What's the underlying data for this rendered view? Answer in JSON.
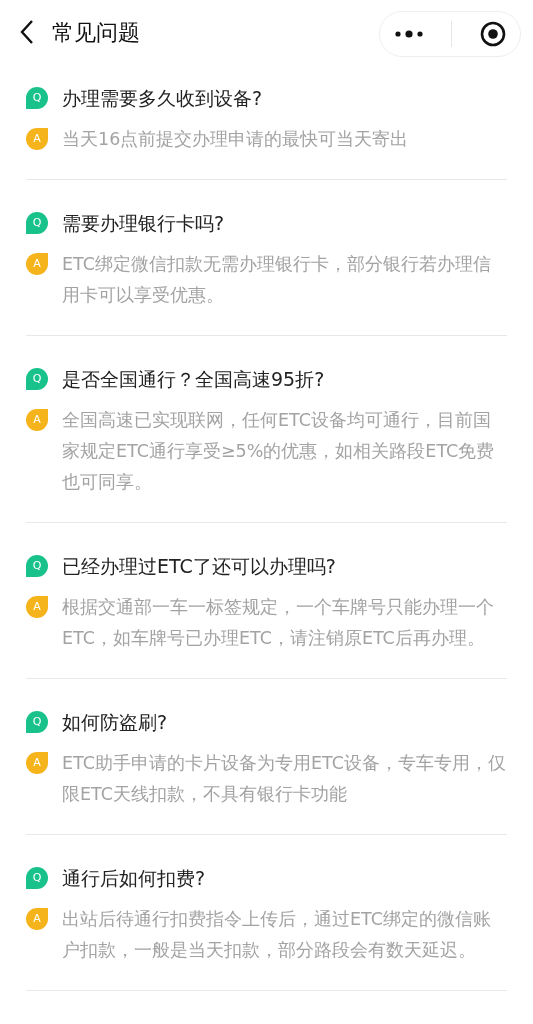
{
  "header": {
    "title": "常见问题"
  },
  "faqs": [
    {
      "q_badge": "Q",
      "question": "办理需要多久收到设备?",
      "a_badge": "A",
      "answer": "当天16点前提交办理申请的最快可当天寄出"
    },
    {
      "q_badge": "Q",
      "question": "需要办理银行卡吗?",
      "a_badge": "A",
      "answer": "ETC绑定微信扣款无需办理银行卡，部分银行若办理信用卡可以享受优惠。"
    },
    {
      "q_badge": "Q",
      "question": "是否全国通行？全国高速95折?",
      "a_badge": "A",
      "answer": "全国高速已实现联网，任何ETC设备均可通行，目前国家规定ETC通行享受≥5%的优惠，如相关路段ETC免费也可同享。"
    },
    {
      "q_badge": "Q",
      "question": "已经办理过ETC了还可以办理吗?",
      "a_badge": "A",
      "answer": "根据交通部一车一标签规定，一个车牌号只能办理一个ETC，如车牌号已办理ETC，请注销原ETC后再办理。"
    },
    {
      "q_badge": "Q",
      "question": "如何防盗刷?",
      "a_badge": "A",
      "answer": "ETC助手申请的卡片设备为专用ETC设备，专车专用，仅限ETC天线扣款，不具有银行卡功能"
    },
    {
      "q_badge": "Q",
      "question": "通行后如何扣费?",
      "a_badge": "A",
      "answer": "出站后待通行扣费指令上传后，通过ETC绑定的微信账户扣款，一般是当天扣款，部分路段会有数天延迟。"
    }
  ]
}
